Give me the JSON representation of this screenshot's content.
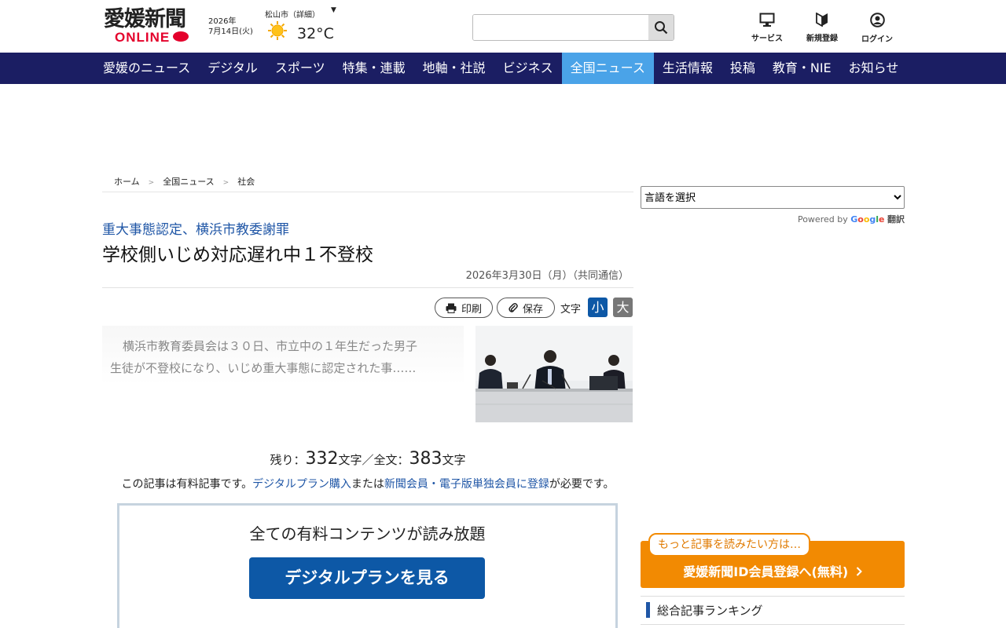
{
  "header": {
    "logo_main": "愛媛新聞",
    "logo_sub": "ONLINE",
    "date_year": "2026年",
    "date_day": "7月14日(火)",
    "weather_city": "松山市（詳細）",
    "weather_caret": "▼",
    "weather_icon": "sun-icon",
    "temperature": "32°C",
    "search_placeholder": "",
    "utility": [
      {
        "label": "サービス",
        "icon": "monitor-icon"
      },
      {
        "label": "新規登録",
        "icon": "beginner-mark-icon"
      },
      {
        "label": "ログイン",
        "icon": "user-circle-icon"
      }
    ]
  },
  "nav": {
    "items": [
      {
        "label": "愛媛のニュース"
      },
      {
        "label": "デジタル"
      },
      {
        "label": "スポーツ"
      },
      {
        "label": "特集・連載"
      },
      {
        "label": "地軸・社説"
      },
      {
        "label": "ビジネス"
      },
      {
        "label": "全国ニュース"
      },
      {
        "label": "生活情報"
      },
      {
        "label": "投稿"
      },
      {
        "label": "教育・NIE"
      },
      {
        "label": "お知らせ"
      }
    ],
    "active_index": 6,
    "active_color": "#4aa3e8",
    "bar_color": "#1b1e63"
  },
  "breadcrumb": {
    "items": [
      "ホーム",
      "全国ニュース",
      "社会"
    ],
    "separator": ">"
  },
  "article": {
    "subhead": "重大事態認定、横浜市教委謝罪",
    "headline": "学校側いじめ対応遅れ中１不登校",
    "date": "2026年3月30日（月）（共同通信）",
    "print_label": "印刷",
    "save_label": "保存",
    "text_size_label": "文字",
    "size_small": "小",
    "size_large": "大",
    "lead_line1": "横浜市教育委員会は３０日、市立中の１年生だった男子",
    "lead_line2": "生徒が不登校になり、いじめ重大事態に認定された事……"
  },
  "paywall": {
    "remain_prefix": "残り：",
    "remain_count": "332",
    "remain_mid": "文字／全文：",
    "total_count": "383",
    "remain_suffix": "文字",
    "notice_pre": "この記事は有料記事です。",
    "notice_link1": "デジタルプラン購入",
    "notice_mid": "または",
    "notice_link2": "新聞会員・電子版単独会員に登録",
    "notice_post": "が必要です。",
    "box_title": "全ての有料コンテンツが読み放題",
    "plan_button": "デジタルプランを見る"
  },
  "sidebar": {
    "language_select": "言語を選択",
    "powered_by": "Powered by",
    "google": "Google",
    "translate": "翻訳",
    "register_bubble": "もっと記事を読みたい方は…",
    "register_button": "愛媛新聞ID会員登録へ(無料)",
    "ranking_title": "総合記事ランキング"
  }
}
